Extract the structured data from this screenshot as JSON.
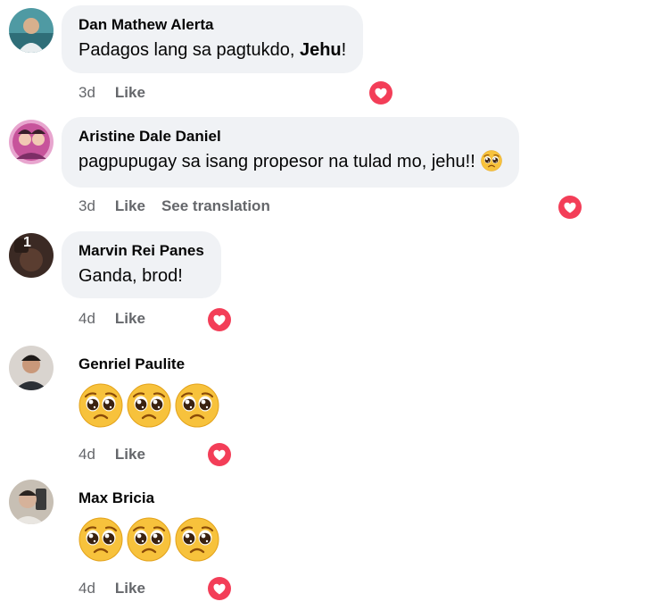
{
  "comments": [
    {
      "author": "Dan Mathew Alerta",
      "text_before": "Padagos lang sa pagtukdo, ",
      "text_bold": "Jehu",
      "text_after": "!",
      "time": "3d",
      "like_label": "Like",
      "reaction_icon": "love-heart-icon"
    },
    {
      "author": "Aristine Dale Daniel",
      "text": "pagpupugay sa isang propesor na tulad mo, jehu!!",
      "text_emoji": "pleading-face-emoji",
      "time": "3d",
      "like_label": "Like",
      "translate_label": "See translation",
      "reaction_icon": "love-heart-icon"
    },
    {
      "author": "Marvin Rei Panes",
      "text": "Ganda, brod!",
      "avatar_badge": "1",
      "time": "4d",
      "like_label": "Like",
      "reaction_icon": "love-heart-icon"
    },
    {
      "author": "Genriel Paulite",
      "emojis": [
        "pleading-face-emoji",
        "pleading-face-emoji",
        "pleading-face-emoji"
      ],
      "time": "4d",
      "like_label": "Like",
      "reaction_icon": "love-heart-icon"
    },
    {
      "author": "Max Bricia",
      "emojis": [
        "pleading-face-emoji",
        "pleading-face-emoji",
        "pleading-face-emoji"
      ],
      "time": "4d",
      "like_label": "Like",
      "reaction_icon": "love-heart-icon"
    }
  ],
  "colors": {
    "bubble": "#f0f2f5",
    "meta_text": "#65676b",
    "love_reaction": "#f33e58"
  }
}
